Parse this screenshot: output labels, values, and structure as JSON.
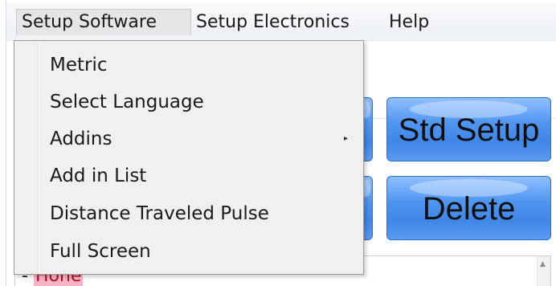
{
  "menubar": {
    "items": [
      {
        "label": "Setup Software"
      },
      {
        "label": "Setup Electronics"
      },
      {
        "label": "Help"
      }
    ]
  },
  "dropdown": {
    "items": [
      {
        "label": "Metric"
      },
      {
        "label": "Select Language"
      },
      {
        "label": "Addins",
        "submenu_arrow": "▸"
      },
      {
        "label": "Add in List"
      },
      {
        "label": "Distance Traveled Pulse"
      },
      {
        "label": "Full Screen"
      }
    ]
  },
  "buttons": {
    "std_setup": "Std Setup",
    "delete": "Delete",
    "color_accent": "#4f95f0"
  },
  "list": {
    "first_item_prefix": "-",
    "first_item_label": "Hone"
  },
  "scrollbar": {
    "up_arrow": "▲"
  }
}
